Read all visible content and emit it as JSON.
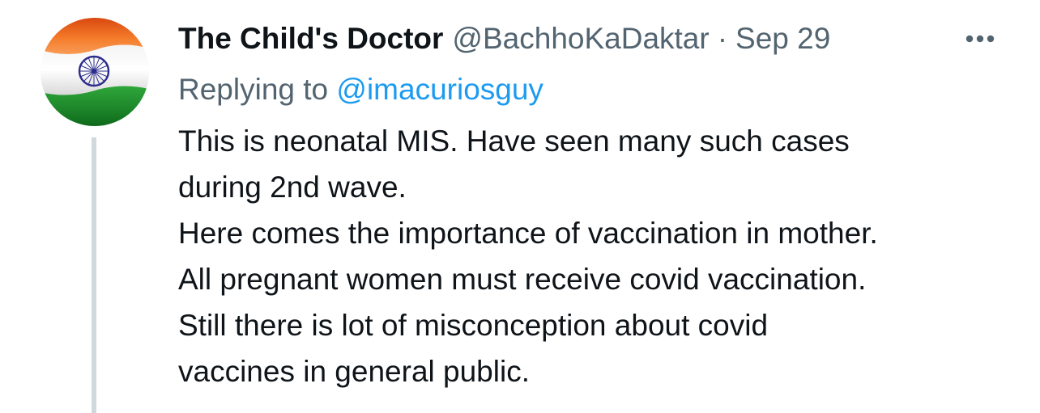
{
  "author": {
    "display_name": "The Child's Doctor",
    "handle": "@BachhoKaDaktar",
    "separator": "·",
    "date": "Sep 29",
    "avatar": "india-flag-avatar"
  },
  "reply": {
    "prefix": "Replying to",
    "mention": "@imacuriosguy"
  },
  "tweet": {
    "lines": [
      "This is neonatal MIS. Have seen many such cases",
      "during 2nd wave.",
      "Here comes the importance of vaccination in mother.",
      "All pregnant women must receive covid vaccination.",
      "Still there is lot of misconception about covid",
      "vaccines in general public."
    ]
  },
  "icons": {
    "more": "more-horizontal-icon"
  },
  "colors": {
    "text": "#0f1419",
    "secondary": "#536471",
    "link": "#1d9bf0",
    "thread_line": "#cfd9de",
    "saffron": "#f26b1d",
    "green": "#1f8a2c",
    "chakra": "#2c2c8c"
  }
}
